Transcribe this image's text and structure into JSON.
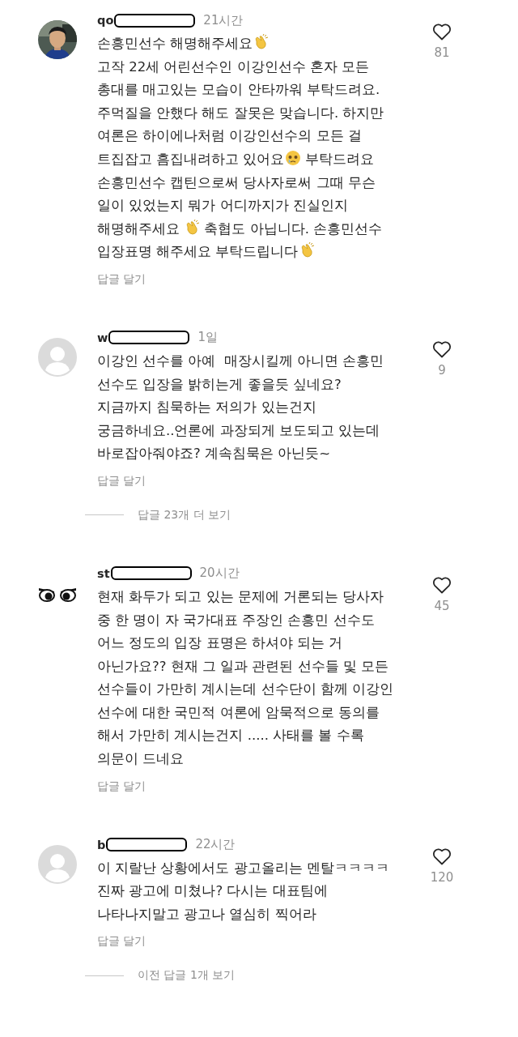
{
  "items": [
    {
      "kind": "comment",
      "username": "qo",
      "redacted": true,
      "time": "21시간",
      "body": [
        {
          "kind": "text",
          "text": "손흥민선수 해명해주세요"
        },
        {
          "kind": "clap"
        },
        {
          "kind": "text",
          "text": "\n고작 22세 어린선수인 이강인선수 혼자 모든\n총대를 매고있는 모습이 안타까워 부탁드려요.\n주먹질을 안했다 해도 잘못은 맞습니다. 하지만\n여론은 하이에나처럼 이강인선수의 모든 걸\n트집잡고 흠집내려하고 있어요"
        },
        {
          "kind": "tear"
        },
        {
          "kind": "text",
          "text": " 부탁드려요\n손흥민선수 캡틴으로써 당사자로써 그때 무슨\n일이 있었는지 뭐가 어디까지가 진실인지\n해명해주세요 "
        },
        {
          "kind": "clap"
        },
        {
          "kind": "text",
          "text": " 축협도 아닙니다. 손흥민선수\n입장표명 해주세요 부탁드립니다"
        },
        {
          "kind": "clap"
        }
      ],
      "likes": "81",
      "reply": "답글 달기"
    },
    {
      "kind": "comment",
      "avatar": {
        "kind": "default"
      },
      "username": "w",
      "redacted": true,
      "time": "1일",
      "body": [
        {
          "kind": "text",
          "text": "이강인 선수를 아예  매장시킬께 아니면 손흥민\n선수도 입장을 밝히는게 좋을듯 싶네요?\n지금까지 침묵하는 저의가 있는건지\n궁금하네요..언론에 과장되게 보도되고 있는데\n바로잡아줘야죠? 계속침묵은 아닌듯~"
        }
      ],
      "likes": "9",
      "reply": "답글 달기"
    },
    {
      "kind": "thread",
      "text": "답글 23개 더 보기"
    },
    {
      "kind": "comment",
      "avatar": {
        "kind": "eyes"
      },
      "username": "st",
      "redacted": true,
      "time": "20시간",
      "body": [
        {
          "kind": "text",
          "text": "현재 화두가 되고 있는 문제에 거론되는 당사자\n중 한 명이 자 국가대표 주장인 손흥민 선수도\n어느 정도의 입장 표명은 하셔야 되는 거\n아닌가요?? 현재 그 일과 관련된 선수들 및 모든\n선수들이 가만히 계시는데 선수단이 함께 이강인\n선수에 대한 국민적 여론에 암묵적으로 동의를\n해서 가만히 계시는건지 ..... 사태를 볼 수록\n의문이 드네요"
        }
      ],
      "likes": "45",
      "reply": "답글 달기"
    },
    {
      "kind": "comment",
      "avatar": {
        "kind": "default"
      },
      "username": "b",
      "redacted": true,
      "time": "22시간",
      "body": [
        {
          "kind": "text",
          "text": "이 지랄난 상황에서도 광고올리는 멘탈ㅋㅋㅋㅋ\n진짜 광고에 미쳤나? 다시는 대표팀에\n나타나지말고 광고나 열심히 찍어라"
        }
      ],
      "likes": "120",
      "reply": "답글 달기"
    },
    {
      "kind": "thread",
      "text": "이전 답글 1개 보기"
    }
  ]
}
